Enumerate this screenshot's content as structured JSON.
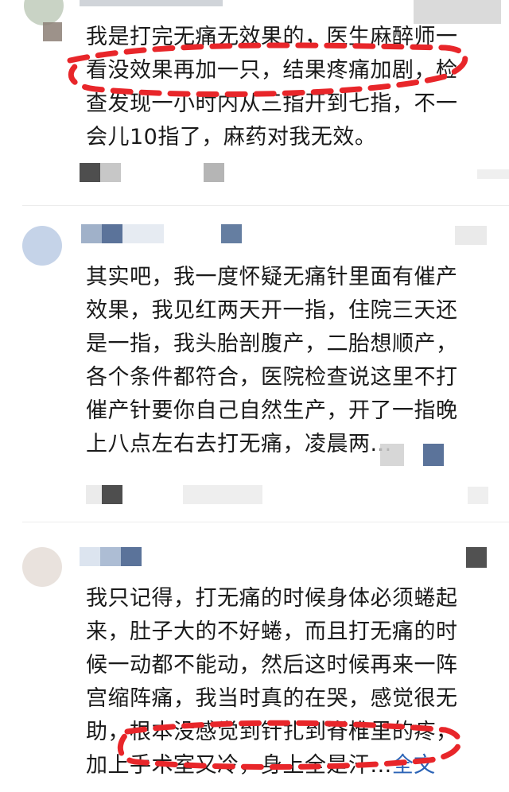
{
  "comments": [
    {
      "text_lines": [
        "我是打完无痛无效果的，医生麻醉师一",
        "看没效果再加一只，结果疼痛加剧，检",
        "查发现一小时内从三指开到七指，不一",
        "会儿10指了，麻药对我无效。"
      ]
    },
    {
      "text_lines": [
        "其实吧，我一度怀疑无痛针里面有催产",
        "效果，我见红两天开一指，住院三天还",
        "是一指，我头胎剖腹产，二胎想顺产，",
        "各个条件都符合，医院检查说这里不打",
        "催产针要你自己自然生产，开了一指晚",
        "上八点左右去打无痛，凌晨两..."
      ]
    },
    {
      "text_lines": [
        "我只记得，打无痛的时候身体必须蜷起",
        "来，肚子大的不好蜷，而且打无痛的时",
        "候一动都不能动，然后这时候再来一阵",
        "宫缩阵痛，我当时真的在哭，感觉很无",
        "助，根本没感觉到针扎到脊椎里的疼，",
        "加上手术室又冷，身上全是汗..."
      ],
      "more_label": "全文"
    }
  ],
  "colors": {
    "annotation": "#e8262a",
    "link": "#2b63b6"
  }
}
